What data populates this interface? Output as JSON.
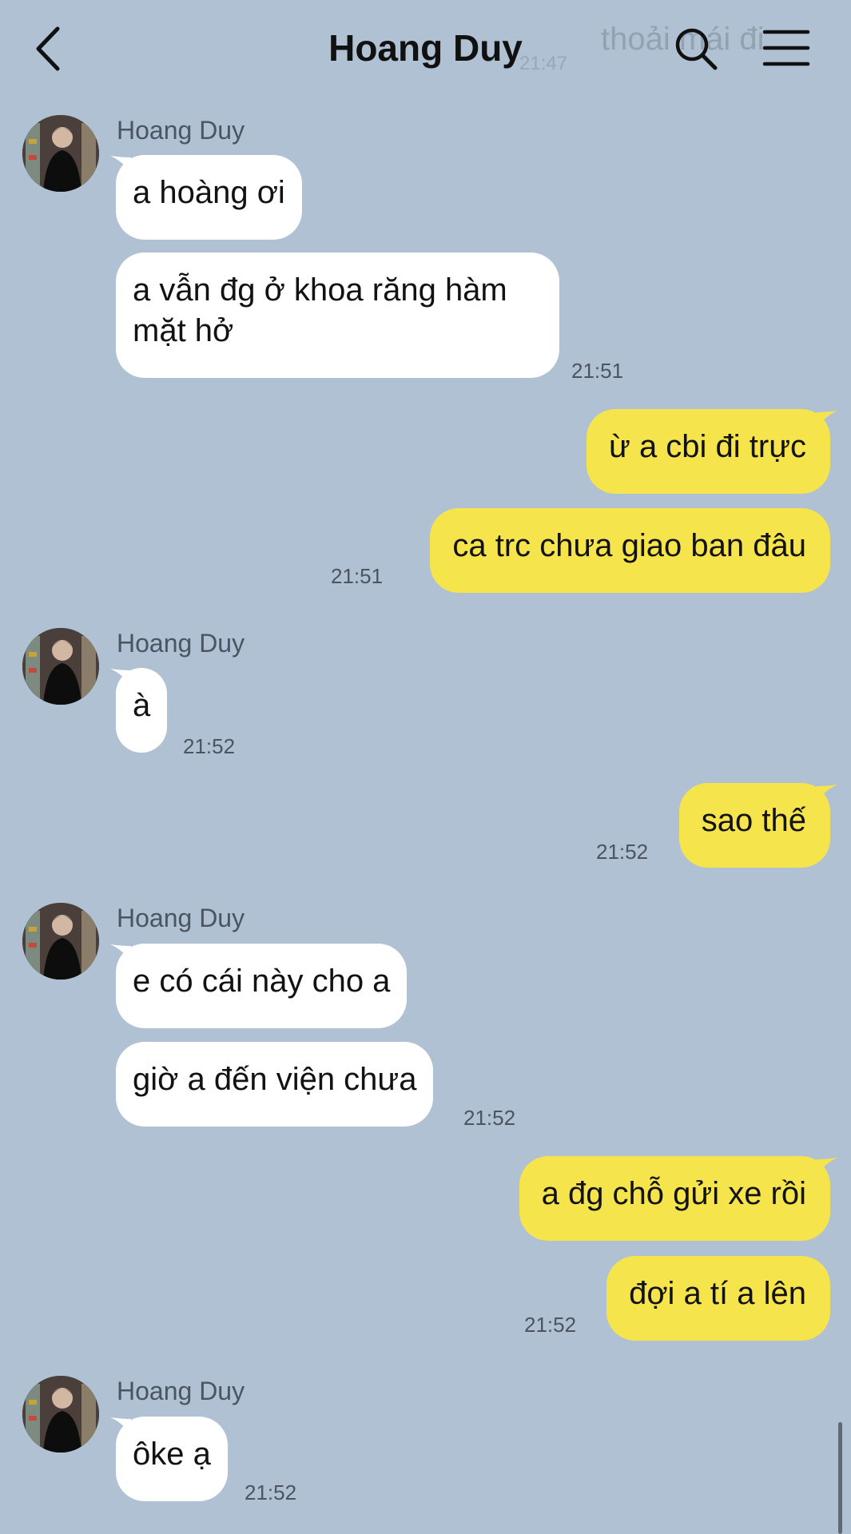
{
  "header": {
    "title": "Hoang Duy",
    "faded_preview": "thoải mái đi",
    "faded_time": "21:47",
    "icons": [
      "back-chevron-icon",
      "search-icon",
      "menu-icon"
    ]
  },
  "colors": {
    "background": "#afc1d2",
    "incoming": "#ffffff",
    "outgoing": "#f6e44d"
  },
  "messages": {
    "g1": {
      "sender": "Hoang Duy",
      "m1": "a hoàng ơi",
      "m2": "a vẫn đg ở khoa răng hàm mặt hở",
      "time": "21:51"
    },
    "g2": {
      "m1": "ừ a cbi đi trực",
      "m2": "ca trc chưa giao ban đâu",
      "time": "21:51"
    },
    "g3": {
      "sender": "Hoang Duy",
      "m1": "à",
      "time": "21:52"
    },
    "g4": {
      "m1": "sao thế",
      "time": "21:52"
    },
    "g5": {
      "sender": "Hoang Duy",
      "m1": "e có cái này cho a",
      "m2": "giờ a đến viện chưa",
      "time": "21:52"
    },
    "g6": {
      "m1": "a đg chỗ gửi xe rồi",
      "m2": "đợi a tí a lên",
      "time": "21:52"
    },
    "g7": {
      "sender": "Hoang Duy",
      "m1": "ôke ạ",
      "time": "21:52"
    }
  }
}
